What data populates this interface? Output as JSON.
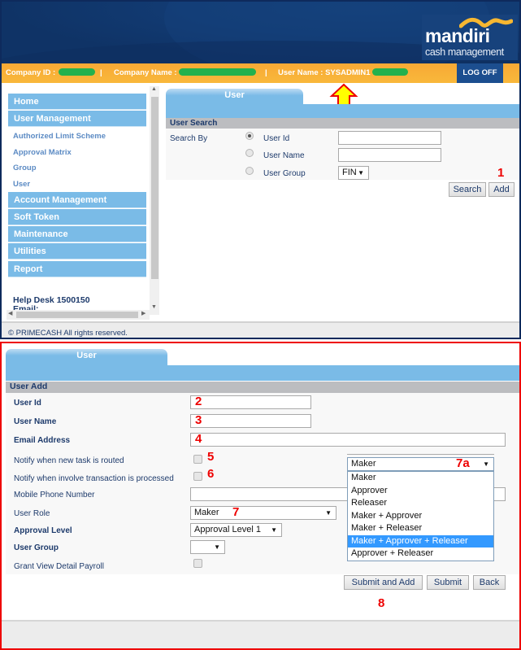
{
  "header": {
    "brand": "mandiri",
    "tagline": "cash management",
    "company_id_label": "Company ID :",
    "company_name_label": "Company Name :",
    "user_name_label": "User Name :",
    "user_name_value": "SYSADMIN1",
    "separator": "|",
    "logoff_label": "LOG OFF",
    "colors": {
      "banner": "#12396f",
      "infobar": "#f8b038",
      "redaction": "#23b14d"
    }
  },
  "sidebar": {
    "items": [
      {
        "label": "Home",
        "type": "main"
      },
      {
        "label": "User Management",
        "type": "main"
      },
      {
        "label": "Authorized Limit Scheme",
        "type": "sub"
      },
      {
        "label": "Approval Matrix",
        "type": "sub"
      },
      {
        "label": "Group",
        "type": "sub"
      },
      {
        "label": "User",
        "type": "sub"
      },
      {
        "label": "Account Management",
        "type": "main"
      },
      {
        "label": "Soft Token",
        "type": "main"
      },
      {
        "label": "Maintenance",
        "type": "main"
      },
      {
        "label": "Utilities",
        "type": "main"
      },
      {
        "label": "Report",
        "type": "main"
      }
    ],
    "helpdesk": "Help Desk 1500150",
    "email_label": "Email:"
  },
  "footer": {
    "copyright": "© PRIMECASH All rights reserved."
  },
  "search": {
    "tab_label": "User",
    "section_title": "User Search",
    "search_by_label": "Search By",
    "options": [
      {
        "label": "User Id",
        "selected": true,
        "value": ""
      },
      {
        "label": "User Name",
        "selected": false,
        "value": ""
      },
      {
        "label": "User Group",
        "selected": false,
        "value": "FIN"
      }
    ],
    "search_button": "Search",
    "add_button": "Add",
    "step": "1"
  },
  "add_form": {
    "tab_label": "User",
    "section_title": "User Add",
    "fields": {
      "user_id": {
        "label": "User Id",
        "value": "",
        "step": "2"
      },
      "user_name": {
        "label": "User Name",
        "value": "",
        "step": "3"
      },
      "email": {
        "label": "Email Address",
        "value": "",
        "step": "4"
      },
      "notify_task": {
        "label": "Notify when new task is routed",
        "checked": false,
        "step": "5"
      },
      "notify_txn": {
        "label": "Notify when involve transaction is processed",
        "checked": false,
        "step": "6"
      },
      "mobile": {
        "label": "Mobile Phone Number",
        "value": ""
      },
      "user_role": {
        "label": "User Role",
        "value": "Maker",
        "step": "7"
      },
      "approval_level": {
        "label": "Approval Level",
        "value": "Approval Level 1"
      },
      "user_group": {
        "label": "User Group",
        "value": ""
      },
      "grant_view": {
        "label": "Grant View Detail Payroll",
        "checked": false
      }
    },
    "role_dropdown": {
      "selected": "Maker",
      "step": "7a",
      "options": [
        "Maker",
        "Approver",
        "Releaser",
        "Maker + Approver",
        "Maker + Releaser",
        "Maker + Approver + Releaser",
        "Approver + Releaser"
      ],
      "highlighted": "Maker + Approver + Releaser"
    },
    "buttons": {
      "submit_add": "Submit and Add",
      "submit": "Submit",
      "back": "Back"
    },
    "step": "8"
  }
}
